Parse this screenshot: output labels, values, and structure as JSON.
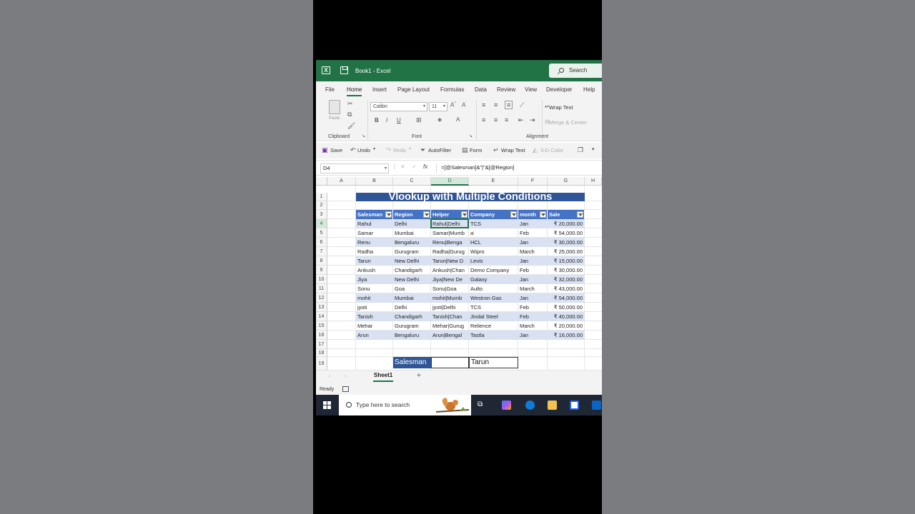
{
  "window": {
    "title": "Book1  -  Excel",
    "search_label": "Search"
  },
  "menu": [
    "File",
    "Home",
    "Insert",
    "Page Layout",
    "Formulas",
    "Data",
    "Review",
    "View",
    "Developer",
    "Help"
  ],
  "ribbon": {
    "paste_label": "Paste",
    "font_name": "Calibri",
    "font_size": "11",
    "groups": {
      "clipboard": "Clipboard",
      "font": "Font",
      "alignment": "Alignment"
    },
    "wrap_text": "Wrap Text",
    "merge_center": "Merge & Center"
  },
  "qat": {
    "save": "Save",
    "undo": "Undo",
    "redo": "Redo",
    "autofilter": "AutoFilter",
    "form": "Form",
    "wrap_text": "Wrap Text",
    "color3d": "3-D Color"
  },
  "formula_bar": {
    "name_box": "D4",
    "fx": "fx",
    "formula": "=[@Salesman]&\"|\"&[@Region]"
  },
  "columns": [
    "A",
    "B",
    "C",
    "D",
    "E",
    "F",
    "G",
    "H"
  ],
  "rows": [
    "1",
    "2",
    "3",
    "4",
    "5",
    "6",
    "7",
    "8",
    "9",
    "10",
    "11",
    "12",
    "13",
    "14",
    "15",
    "16",
    "17",
    "18",
    "19"
  ],
  "sheet_title": "Vlookup with Multiple Conditions",
  "table": {
    "headers": [
      "Salesman",
      "Region",
      "Helper",
      "Company",
      "month",
      "Sale"
    ],
    "rows": [
      [
        "Rahul",
        "Delhi",
        "Rahul|Delhi",
        "TCS",
        "Jan",
        "₹ 20,000.00"
      ],
      [
        "Samar",
        "Mumbai",
        "Samar|Mumb",
        "a",
        "Feb",
        "₹ 54,000.00"
      ],
      [
        "Renu",
        "Bengaluru",
        "Renu|Benga",
        "HCL",
        "Jan",
        "₹ 30,000.00"
      ],
      [
        "Radha",
        "Gurugram",
        "Radha|Gurug",
        "Wipro",
        "March",
        "₹ 25,000.00"
      ],
      [
        "Tarun",
        "New Delhi",
        "Tarun|New D",
        "Levis",
        "Jan",
        "₹ 15,000.00"
      ],
      [
        "Ankush",
        "Chandigarh",
        "Ankush|Chan",
        "Demo Company",
        "Feb",
        "₹ 30,000.00"
      ],
      [
        "Jiya",
        "New Delhi",
        "Jiya|New De",
        "Galaxy",
        "Jan",
        "₹ 32,000.00"
      ],
      [
        "Sonu",
        "Goa",
        "Sonu|Goa",
        "Aulto",
        "March",
        "₹ 43,000.00"
      ],
      [
        "mohit",
        "Mumbai",
        "mohit|Mumb",
        "Westron Gas",
        "Jan",
        "₹ 54,000.00"
      ],
      [
        "jyoti",
        "Delhi",
        "jyoti|Delhi",
        "TCS",
        "Feb",
        "₹ 50,000.00"
      ],
      [
        "Tanish",
        "Chandigarh",
        "Tanish|Chan",
        "Jindal Steel",
        "Feb",
        "₹ 40,000.00"
      ],
      [
        "Mehar",
        "Gurugram",
        "Mehar|Gurug",
        "Relience",
        "March",
        "₹ 20,000.00"
      ],
      [
        "Arun",
        "Bengaluru",
        "Arun|Bengal",
        "Tastla",
        "Jan",
        "₹ 16,000.00"
      ]
    ]
  },
  "lookup": {
    "label": "Salesman",
    "value": "Tarun"
  },
  "sheet_tab": "Sheet1",
  "status": "Ready",
  "taskbar": {
    "search_placeholder": "Type here to search"
  },
  "colors": {
    "excel_green": "#217346",
    "title_fill": "#2f5597",
    "header_fill": "#4472c4",
    "band_fill": "#d9e1f2"
  }
}
